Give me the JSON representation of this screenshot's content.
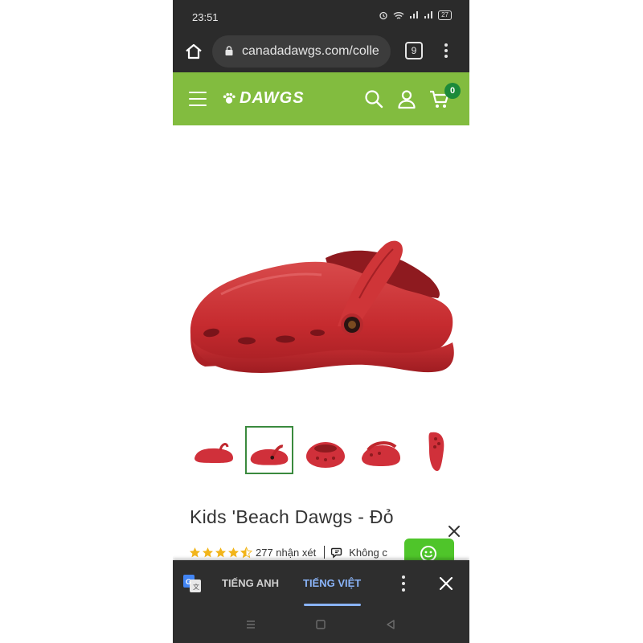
{
  "status_bar": {
    "time": "23:51",
    "battery": "27"
  },
  "browser": {
    "url": "canadadawgs.com/colle",
    "tab_count": "9"
  },
  "site_header": {
    "logo_text": "DAWGS",
    "cart_count": "0",
    "color": "#82bc3f"
  },
  "product": {
    "title": "Kids 'Beach Dawgs - Đỏ",
    "rating": 4.5,
    "rating_max": 5,
    "reviews_text": "277 nhận xét",
    "chat_text": "Không c",
    "thumbnail_count": 5,
    "active_thumbnail": 2,
    "color": "#d62b2e"
  },
  "translate_bar": {
    "source_lang": "TIẾNG ANH",
    "target_lang": "TIẾNG VIỆT",
    "active_color": "#8ab4f8"
  },
  "icons": {
    "home": "home-icon",
    "lock": "lock-icon",
    "menu": "more-vert-icon",
    "hamburger": "hamburger-menu-icon",
    "search": "search-icon",
    "account": "user-icon",
    "cart": "cart-icon",
    "chat": "chat-icon",
    "close": "close-icon",
    "translate": "google-translate-icon"
  }
}
